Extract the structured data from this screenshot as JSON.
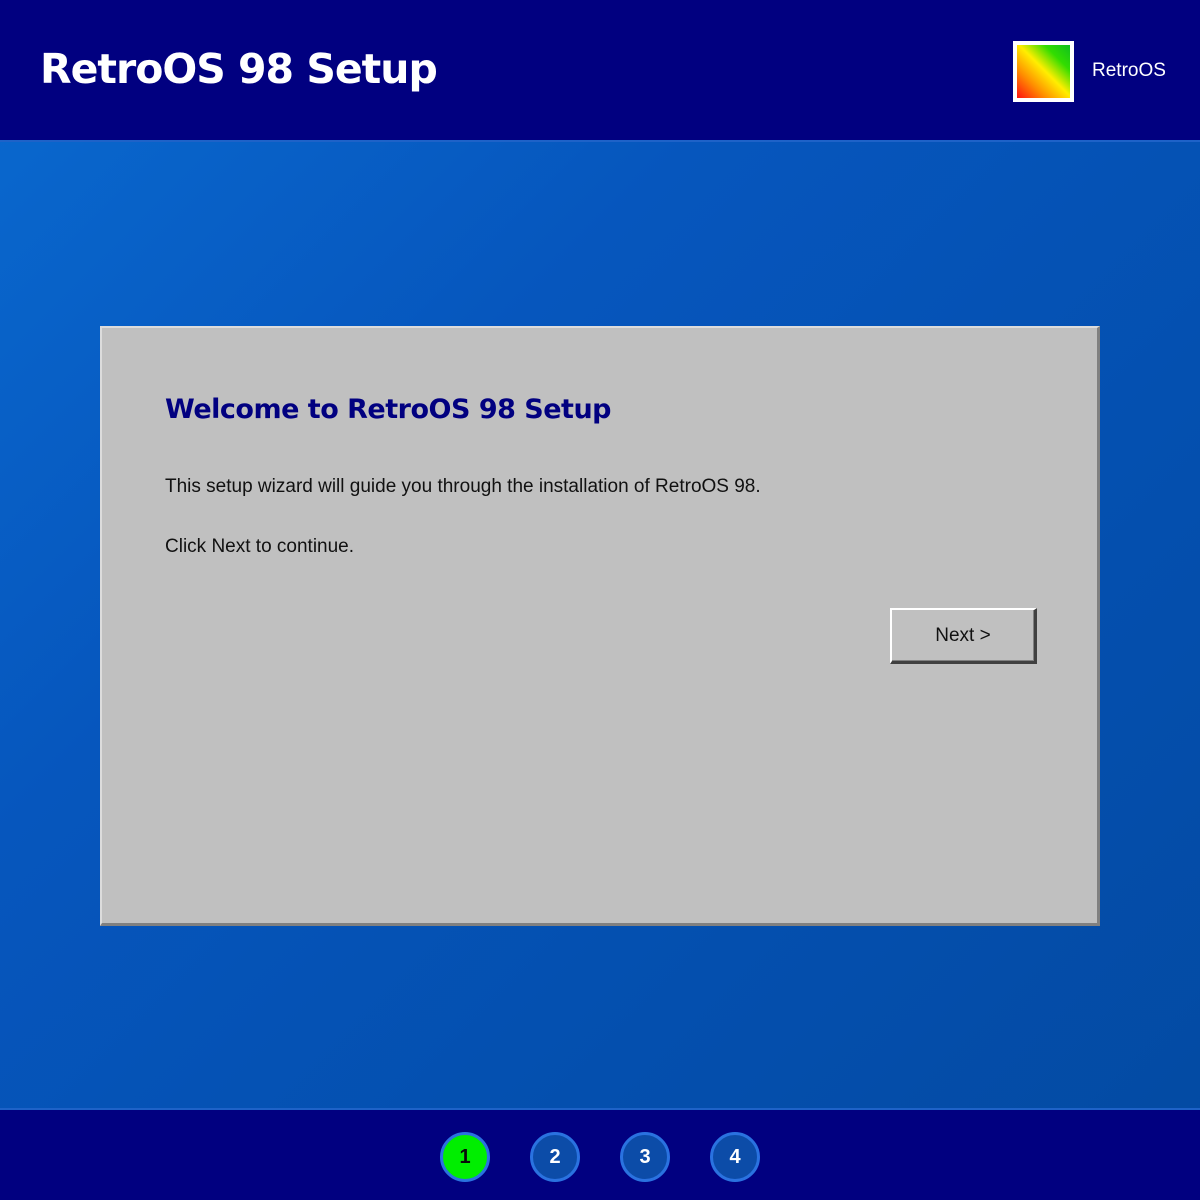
{
  "header": {
    "title": "RetroOS 98 Setup",
    "brand": "RetroOS",
    "logo_icon": "retroos-logo"
  },
  "dialog": {
    "title": "Welcome to RetroOS 98 Setup",
    "intro": "This setup wizard will guide you through the installation of RetroOS 98.",
    "instruction": "Click Next to continue.",
    "next_label": "Next >"
  },
  "steps": {
    "current": 1,
    "items": [
      {
        "label": "1"
      },
      {
        "label": "2"
      },
      {
        "label": "3"
      },
      {
        "label": "4"
      }
    ]
  },
  "colors": {
    "header_bg": "#010080",
    "title_text": "#010080",
    "dialog_bg": "#c0c0c0",
    "active_step": "#00ee00",
    "desktop_blue": "#0656bd"
  }
}
